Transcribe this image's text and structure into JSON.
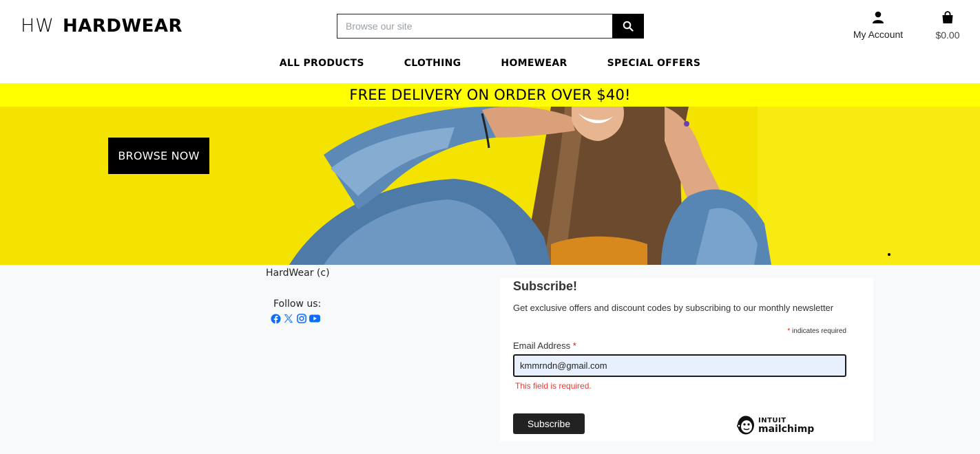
{
  "header": {
    "logo_mark": "HW",
    "logo_name": "HARDWEAR",
    "search_placeholder": "Browse our site",
    "account_label": "My Account",
    "cart_total": "$0.00"
  },
  "nav": {
    "items": [
      "ALL PRODUCTS",
      "CLOTHING",
      "HOMEWEAR",
      "SPECIAL OFFERS"
    ]
  },
  "banner": {
    "delivery_text": "FREE DELIVERY ON ORDER OVER $40!",
    "browse_button": "BROWSE NOW"
  },
  "footer": {
    "copyright": "HardWear (c)",
    "follow_label": "Follow us:",
    "social_icons": [
      "facebook-icon",
      "x-icon",
      "instagram-icon",
      "youtube-icon"
    ],
    "social_color": "#0d6efd"
  },
  "subscribe": {
    "title": "Subscribe!",
    "description": "Get exclusive offers and discount codes by subscribing to our monthly newsletter",
    "required_asterisk": "*",
    "required_note": " indicates required",
    "email_label": "Email Address ",
    "email_value": "kmmrndn@gmail.com",
    "error_text": "This field is required.",
    "button_label": "Subscribe",
    "brand_line1": "INTUIT",
    "brand_line2": "mailchimp"
  },
  "colors": {
    "banner_yellow": "#ffff00",
    "hero_yellow": "#f4e300",
    "error_red": "#e53935"
  }
}
